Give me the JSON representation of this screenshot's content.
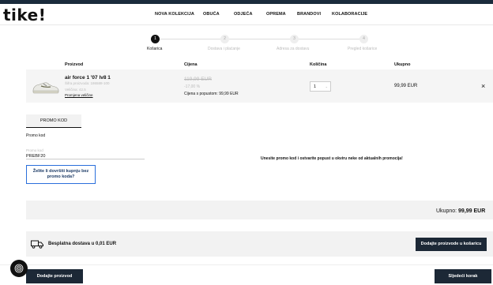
{
  "header": {
    "logo": "tike!",
    "nav": [
      "NOVA KOLEKCIJA",
      "OBUĆA",
      "ODJEĆA",
      "OPREMA",
      "BRANDOVI",
      "KOLABORACIJE"
    ]
  },
  "steps": [
    {
      "num": "1",
      "label": "Košarica",
      "active": true
    },
    {
      "num": "2",
      "label": "Dostava i plaćanje",
      "active": false
    },
    {
      "num": "3",
      "label": "Adresa za dostavu",
      "active": false
    },
    {
      "num": "4",
      "label": "Pregled košarice",
      "active": false
    }
  ],
  "table": {
    "headers": {
      "product": "Proizvod",
      "price": "Cijena",
      "qty": "Količina",
      "total": "Ukupno"
    },
    "item": {
      "name": "air force 1 '07 lv8 1",
      "code": "Šifra proizvoda: 186588-100",
      "size": "Veličina: 42.5",
      "change_size": "Promjena veličine",
      "old_price": "119,99 EUR",
      "discount": "-17,00 %",
      "discounted": "Cijena s popustom: 99,99 EUR",
      "qty": "1",
      "total": "99,99 EUR"
    }
  },
  "promo": {
    "tab": "PROMO KOD",
    "label": "Promo kod",
    "field_label": "Promo kod",
    "value": "PREBF20",
    "buy_button": "Želite li dovršiti kupnju bez promo koda?",
    "message": "Unesite promo kod i ostvarite popust u okviru neke od aktualnih promocija!"
  },
  "summary": {
    "label": "Ukupno:",
    "value": "99,99 EUR"
  },
  "delivery": {
    "text": "Besplatna dostava u 0,01 EUR",
    "button": "Dodajte proizvode u košaricu"
  },
  "bottom": {
    "left": "Dodajte proizvod",
    "right": "Sljedeći korak"
  },
  "colors": {
    "dark": "#1c2836",
    "accent_border": "#2a6fdb"
  }
}
